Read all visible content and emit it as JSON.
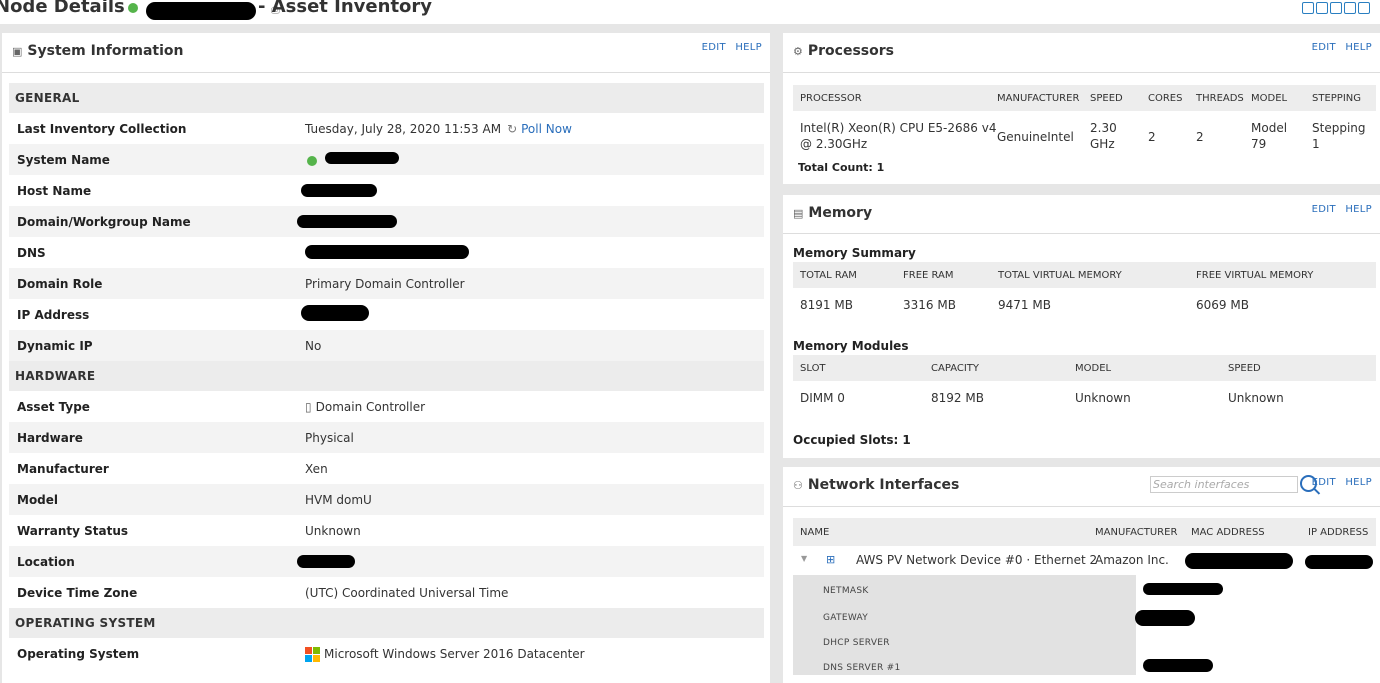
{
  "header": {
    "title_prefix": "Node Details -",
    "title_suffix": "- Asset Inventory"
  },
  "system_info": {
    "title": "System Information",
    "edit": "EDIT",
    "help": "HELP",
    "sections": {
      "general": "GENERAL",
      "hardware": "HARDWARE",
      "os": "OPERATING SYSTEM"
    },
    "rows": {
      "last_inventory": {
        "label": "Last Inventory Collection",
        "value": "Tuesday, July 28, 2020 11:53 AM",
        "poll": "Poll Now"
      },
      "system_name": {
        "label": "System Name"
      },
      "host_name": {
        "label": "Host Name"
      },
      "domain_workgroup": {
        "label": "Domain/Workgroup Name"
      },
      "dns": {
        "label": "DNS"
      },
      "domain_role": {
        "label": "Domain Role",
        "value": "Primary Domain Controller"
      },
      "ip_address": {
        "label": "IP Address"
      },
      "dynamic_ip": {
        "label": "Dynamic IP",
        "value": "No"
      },
      "asset_type": {
        "label": "Asset Type",
        "value": "Domain Controller"
      },
      "hardware": {
        "label": "Hardware",
        "value": "Physical"
      },
      "manufacturer": {
        "label": "Manufacturer",
        "value": "Xen"
      },
      "model": {
        "label": "Model",
        "value": "HVM domU"
      },
      "warranty": {
        "label": "Warranty Status",
        "value": "Unknown"
      },
      "location": {
        "label": "Location"
      },
      "time_zone": {
        "label": "Device Time Zone",
        "value": "(UTC) Coordinated Universal Time"
      },
      "os": {
        "label": "Operating System",
        "value": "Microsoft Windows Server 2016 Datacenter"
      }
    }
  },
  "processors": {
    "title": "Processors",
    "edit": "EDIT",
    "help": "HELP",
    "headers": [
      "PROCESSOR",
      "MANUFACTURER",
      "SPEED",
      "CORES",
      "THREADS",
      "MODEL",
      "STEPPING"
    ],
    "row": {
      "processor_l1": "Intel(R) Xeon(R) CPU E5-2686 v4",
      "processor_l2": "@ 2.30GHz",
      "manufacturer": "GenuineIntel",
      "speed_l1": "2.30",
      "speed_l2": "GHz",
      "cores": "2",
      "threads": "2",
      "model_l1": "Model",
      "model_l2": "79",
      "stepping_l1": "Stepping",
      "stepping_l2": "1"
    },
    "total": "Total Count: 1"
  },
  "memory": {
    "title": "Memory",
    "edit": "EDIT",
    "help": "HELP",
    "summary_title": "Memory Summary",
    "summary_headers": [
      "TOTAL RAM",
      "FREE RAM",
      "TOTAL VIRTUAL MEMORY",
      "FREE VIRTUAL MEMORY"
    ],
    "summary_values": [
      "8191 MB",
      "3316 MB",
      "9471 MB",
      "6069 MB"
    ],
    "modules_title": "Memory Modules",
    "modules_headers": [
      "SLOT",
      "CAPACITY",
      "MODEL",
      "SPEED"
    ],
    "modules_values": [
      "DIMM 0",
      "8192 MB",
      "Unknown",
      "Unknown"
    ],
    "occupied": "Occupied Slots: 1"
  },
  "network": {
    "title": "Network Interfaces",
    "edit": "EDIT",
    "help": "HELP",
    "search_placeholder": "Search interfaces",
    "headers": [
      "NAME",
      "MANUFACTURER",
      "MAC ADDRESS",
      "IP ADDRESS"
    ],
    "row": {
      "name": "AWS PV Network Device #0 · Ethernet 2",
      "manufacturer": "Amazon Inc."
    },
    "sub_labels": [
      "NETMASK",
      "GATEWAY",
      "DHCP SERVER",
      "DNS SERVER #1"
    ]
  }
}
